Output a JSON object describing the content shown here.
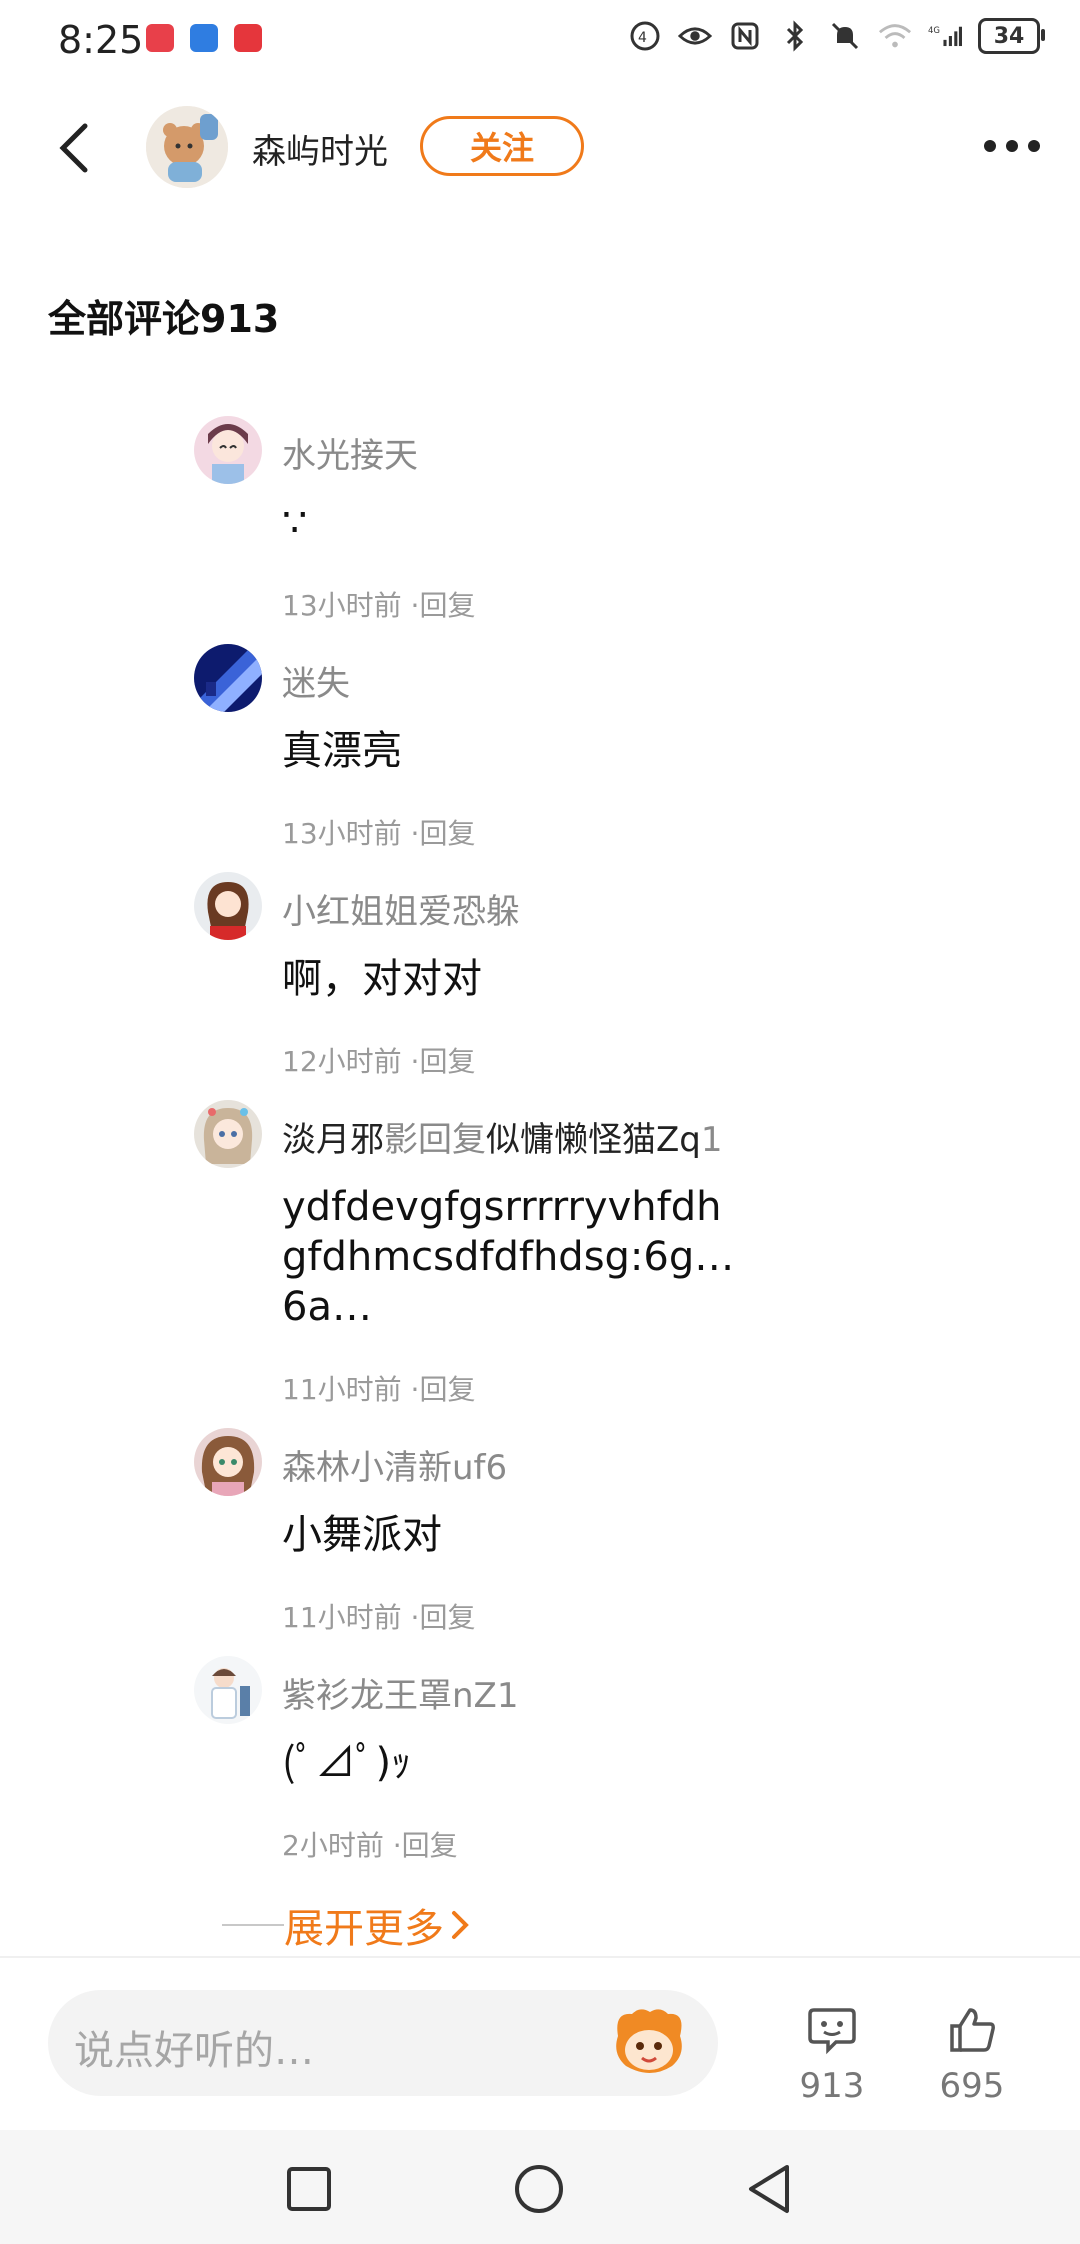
{
  "status_bar": {
    "time": "8:25",
    "battery": "34",
    "icons": [
      "notes-app-icon",
      "bulb-app-icon",
      "app-icon",
      "hd-icon",
      "eye-icon",
      "nfc-icon",
      "bluetooth-icon",
      "mute-icon",
      "wifi-icon",
      "signal-4g-icon"
    ]
  },
  "header": {
    "author_name": "森屿时光",
    "follow_label": "关注"
  },
  "section_title": "全部评论913",
  "comments": [
    {
      "name": "水光接天",
      "text": "∵",
      "time": "13小时前",
      "reply": "·回复"
    },
    {
      "name": "迷失",
      "text": "真漂亮",
      "time": "13小时前",
      "reply": "·回复"
    },
    {
      "name": "小红姐姐爱恐躲",
      "text": "啊，对对对",
      "time": "12小时前",
      "reply": "·回复"
    },
    {
      "name": "淡月邪",
      "reply_word": "影回复",
      "reply_target": "似慵懒怪猫Zq",
      "reply_suffix": "1",
      "text": "ydfdevgfgsrrrrryvhfdh gfdhmcsdfdfhdsg:6g… 6a…",
      "time": "11小时前",
      "reply": "·回复"
    },
    {
      "name": "森林小清新uf6",
      "text": "小舞派对",
      "time": "11小时前",
      "reply": "·回复"
    },
    {
      "name": "紫衫龙王罩nZ1",
      "text": "(ﾟ⊿ﾟ)ｯ",
      "time": "2小时前",
      "reply": "·回复"
    }
  ],
  "expand_label": "展开更多",
  "input": {
    "placeholder": "说点好听的…"
  },
  "stats": {
    "comments": "913",
    "likes": "695"
  },
  "colors": {
    "accent": "#f07a1a",
    "muted": "#8a8a8a"
  }
}
